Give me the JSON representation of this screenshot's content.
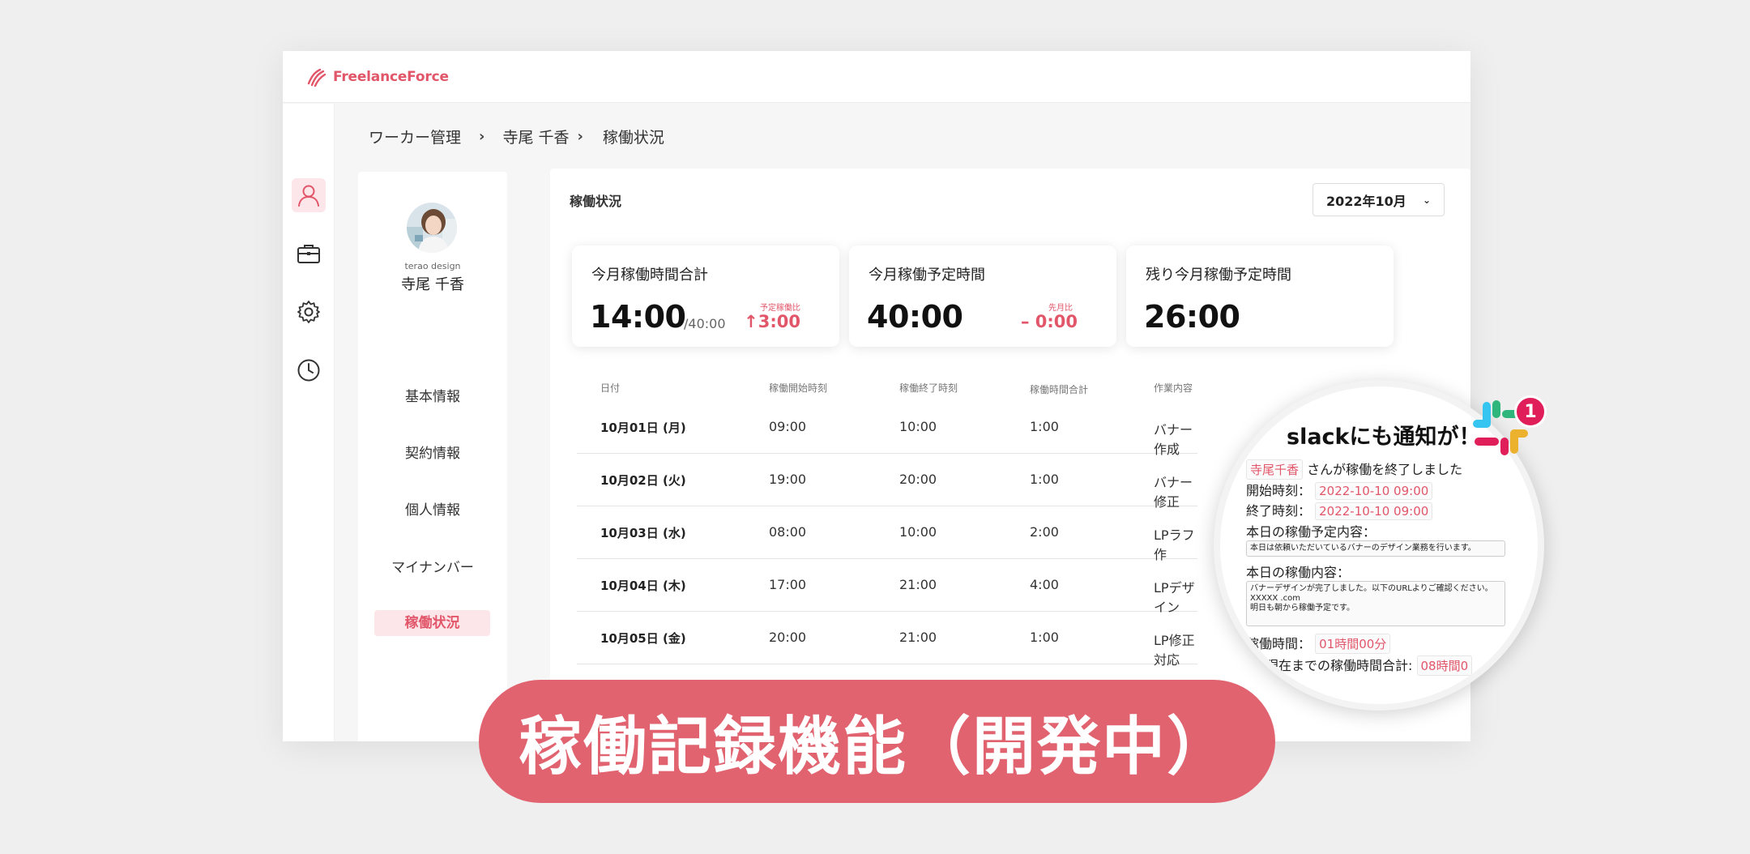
{
  "app": {
    "logo_text": "FreelanceForce",
    "brand_color": "#e2566a"
  },
  "sidenav": {
    "items": [
      {
        "icon": "user-icon",
        "active": true
      },
      {
        "icon": "briefcase-icon",
        "active": false
      },
      {
        "icon": "gear-icon",
        "active": false
      },
      {
        "icon": "clock-icon",
        "active": false
      }
    ]
  },
  "breadcrumb": {
    "items": [
      "ワーカー管理",
      "寺尾 千香",
      "稼働状況"
    ],
    "separator": "›"
  },
  "profile": {
    "company": "terao design",
    "name": "寺尾 千香",
    "menu": [
      "基本情報",
      "契約情報",
      "個人情報",
      "マイナンバー",
      "稼働状況"
    ],
    "active_index": 4
  },
  "main": {
    "title": "稼働状況",
    "month_select": "2022年10月",
    "cards": [
      {
        "title": "今月稼働時間合計",
        "value": "14:00",
        "sub": "/40:00",
        "label": "予定稼働比",
        "delta": "3:00",
        "delta_prefix": "↑"
      },
      {
        "title": "今月稼働予定時間",
        "value": "40:00",
        "sub": "",
        "label": "先月比",
        "delta": "0:00",
        "delta_prefix": "–"
      },
      {
        "title": "残り今月稼働予定時間",
        "value": "26:00",
        "sub": "",
        "label": "",
        "delta": "",
        "delta_prefix": ""
      }
    ],
    "table": {
      "headers": [
        "日付",
        "稼働開始時刻",
        "稼働終了時刻",
        "稼働時間合計",
        "作業内容"
      ],
      "rows": [
        [
          "10月01日 (月)",
          "09:00",
          "10:00",
          "1:00",
          "バナー作成"
        ],
        [
          "10月02日 (火)",
          "19:00",
          "20:00",
          "1:00",
          "バナー修正"
        ],
        [
          "10月03日 (水)",
          "08:00",
          "10:00",
          "2:00",
          "LPラフ作"
        ],
        [
          "10月04日 (木)",
          "17:00",
          "21:00",
          "4:00",
          "LPデザイン"
        ],
        [
          "10月05日 (金)",
          "20:00",
          "21:00",
          "1:00",
          "LP修正対応"
        ]
      ]
    }
  },
  "slack_bubble": {
    "title": "slackにも通知が！",
    "badge": "1",
    "user_tag": "寺尾千香",
    "message": "さんが稼働を終了しました",
    "start_label": "開始時刻：",
    "start_value": "2022-10-10 09:00",
    "end_label": "終了時刻：",
    "end_value": "2022-10-10 09:00",
    "plan_label": "本日の稼働予定内容：",
    "plan_text": "本日は依頼いただいているバナーのデザイン業務を行います。",
    "content_label": "本日の稼働内容：",
    "content_lines": [
      "バナーデザインが完了しました。以下のURLよりご確認ください。",
      "XXXXX .com",
      "明日も朝から稼働予定です。"
    ],
    "hours_label": "稼働時間：",
    "hours_value": "01時間00分",
    "total_label": "現在までの稼働時間合計:",
    "total_value": "08時間0"
  },
  "banner": {
    "text": "稼働記録機能（開発中）",
    "color": "#e0636f"
  }
}
